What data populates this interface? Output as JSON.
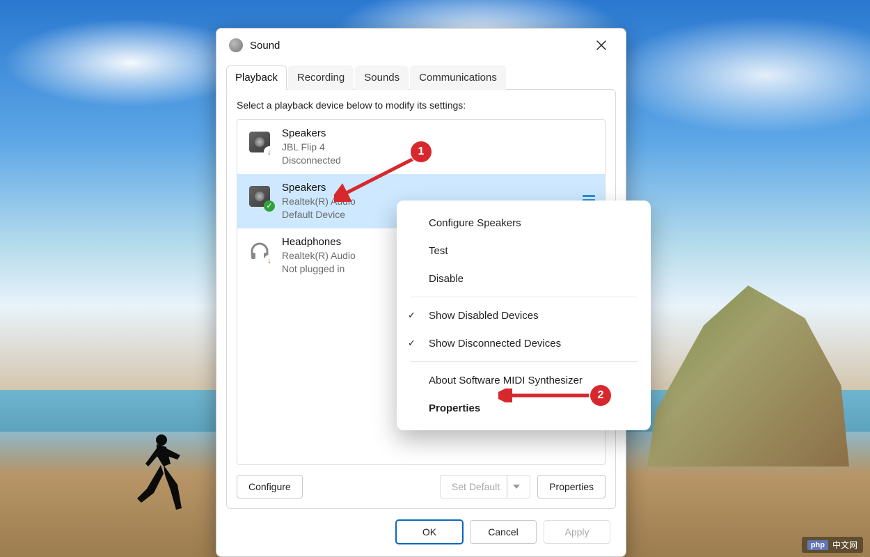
{
  "window": {
    "title": "Sound",
    "instruction": "Select a playback device below to modify its settings:"
  },
  "tabs": [
    {
      "label": "Playback",
      "active": true
    },
    {
      "label": "Recording",
      "active": false
    },
    {
      "label": "Sounds",
      "active": false
    },
    {
      "label": "Communications",
      "active": false
    }
  ],
  "devices": [
    {
      "name": "Speakers",
      "subtitle": "JBL Flip 4",
      "status": "Disconnected",
      "badge": "disconnected",
      "selected": false,
      "icon": "speaker"
    },
    {
      "name": "Speakers",
      "subtitle": "Realtek(R) Audio",
      "status": "Default Device",
      "badge": "default",
      "selected": true,
      "icon": "speaker"
    },
    {
      "name": "Headphones",
      "subtitle": "Realtek(R) Audio",
      "status": "Not plugged in",
      "badge": "disconnected",
      "selected": false,
      "icon": "headphone"
    }
  ],
  "panel_buttons": {
    "configure": "Configure",
    "set_default": "Set Default",
    "properties": "Properties"
  },
  "dialog_buttons": {
    "ok": "OK",
    "cancel": "Cancel",
    "apply": "Apply"
  },
  "context_menu": {
    "items": [
      {
        "label": "Configure Speakers",
        "checked": false,
        "bold": false
      },
      {
        "label": "Test",
        "checked": false,
        "bold": false
      },
      {
        "label": "Disable",
        "checked": false,
        "bold": false,
        "sep_after": true
      },
      {
        "label": "Show Disabled Devices",
        "checked": true,
        "bold": false
      },
      {
        "label": "Show Disconnected Devices",
        "checked": true,
        "bold": false,
        "sep_after": true
      },
      {
        "label": "About Software MIDI Synthesizer",
        "checked": false,
        "bold": false
      },
      {
        "label": "Properties",
        "checked": false,
        "bold": true
      }
    ]
  },
  "callouts": {
    "one": "1",
    "two": "2"
  },
  "watermark": {
    "badge": "php",
    "text": "中文网"
  }
}
